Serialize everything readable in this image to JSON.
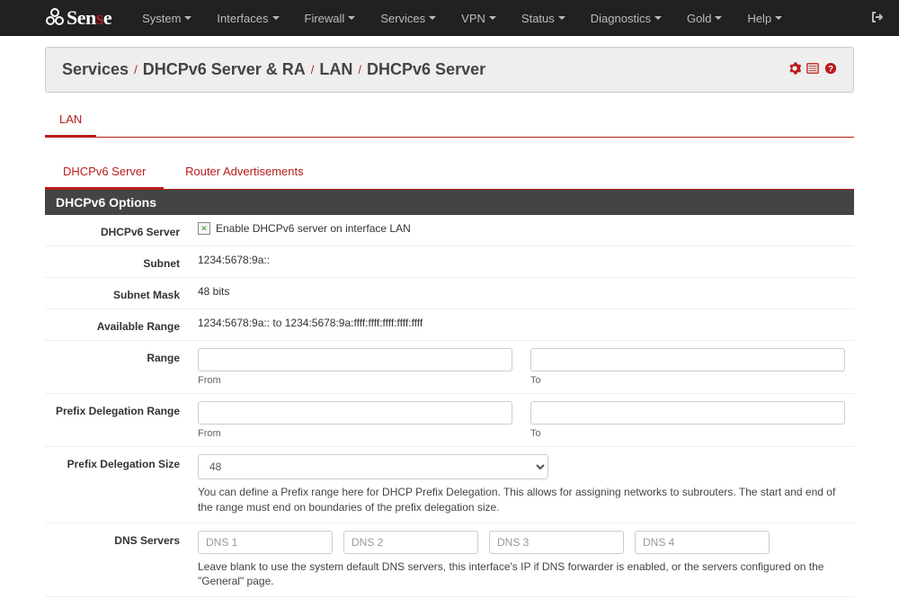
{
  "brand": {
    "name_pre": "Sen",
    "name_s": "s",
    "name_post": "e"
  },
  "nav": [
    "System",
    "Interfaces",
    "Firewall",
    "Services",
    "VPN",
    "Status",
    "Diagnostics",
    "Gold",
    "Help"
  ],
  "breadcrumb": {
    "a": "Services",
    "b": "DHCPv6 Server & RA",
    "c": "LAN",
    "d": "DHCPv6 Server"
  },
  "outer_tabs": [
    "LAN"
  ],
  "sub_tabs": [
    "DHCPv6 Server",
    "Router Advertisements"
  ],
  "panel_title": "DHCPv6 Options",
  "rows": {
    "dhcpv6_server": {
      "label": "DHCPv6 Server",
      "chk_label": "Enable DHCPv6 server on interface LAN"
    },
    "subnet": {
      "label": "Subnet",
      "value": "1234:5678:9a::"
    },
    "subnet_mask": {
      "label": "Subnet Mask",
      "value": "48 bits"
    },
    "available_range": {
      "label": "Available Range",
      "value": "1234:5678:9a:: to 1234:5678:9a:ffff:ffff:ffff:ffff:ffff"
    },
    "range": {
      "label": "Range",
      "from": "From",
      "to": "To"
    },
    "pd_range": {
      "label": "Prefix Delegation Range",
      "from": "From",
      "to": "To"
    },
    "pd_size": {
      "label": "Prefix Delegation Size",
      "value": "48",
      "help": "You can define a Prefix range here for DHCP Prefix Delegation. This allows for assigning networks to subrouters. The start and end of the range must end on boundaries of the prefix delegation size."
    },
    "dns": {
      "label": "DNS Servers",
      "placeholders": [
        "DNS 1",
        "DNS 2",
        "DNS 3",
        "DNS 4"
      ],
      "help": "Leave blank to use the system default DNS servers, this interface's IP if DNS forwarder is enabled, or the servers configured on the \"General\" page."
    }
  }
}
